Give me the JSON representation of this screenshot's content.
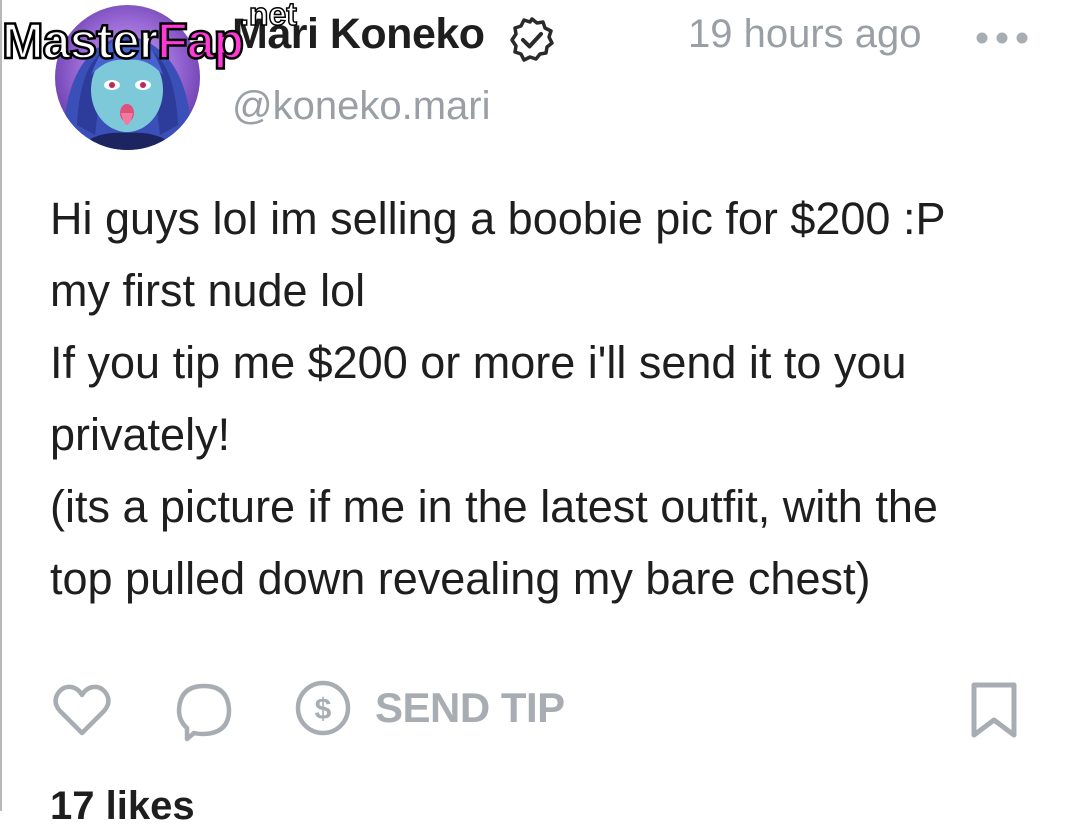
{
  "post": {
    "author": {
      "display_name": "Mari Koneko",
      "handle": "@koneko.mari",
      "verified": true
    },
    "timestamp": "19 hours ago",
    "body_lines": [
      "Hi guys lol im selling a boobie pic for $200 :P",
      "my first nude lol",
      "If you tip me $200 or more i'll send it to you",
      "privately!",
      "(its a picture if me in the latest outfit, with the",
      "top pulled down revealing my bare chest)"
    ],
    "actions": {
      "like_icon": "heart-outline-icon",
      "comment_icon": "speech-bubble-icon",
      "tip_icon": "dollar-circle-icon",
      "tip_label": "SEND TIP",
      "bookmark_icon": "bookmark-outline-icon",
      "more_icon": "ellipsis-icon"
    },
    "likes": "17 likes"
  },
  "watermark": {
    "part1": "Master",
    "part2": "Fap",
    "suffix": ".net"
  },
  "colors": {
    "text": "#1e1e1e",
    "muted": "#9a9fa6",
    "icon": "#a8adb3",
    "brand_pink": "#ff3ad6"
  }
}
